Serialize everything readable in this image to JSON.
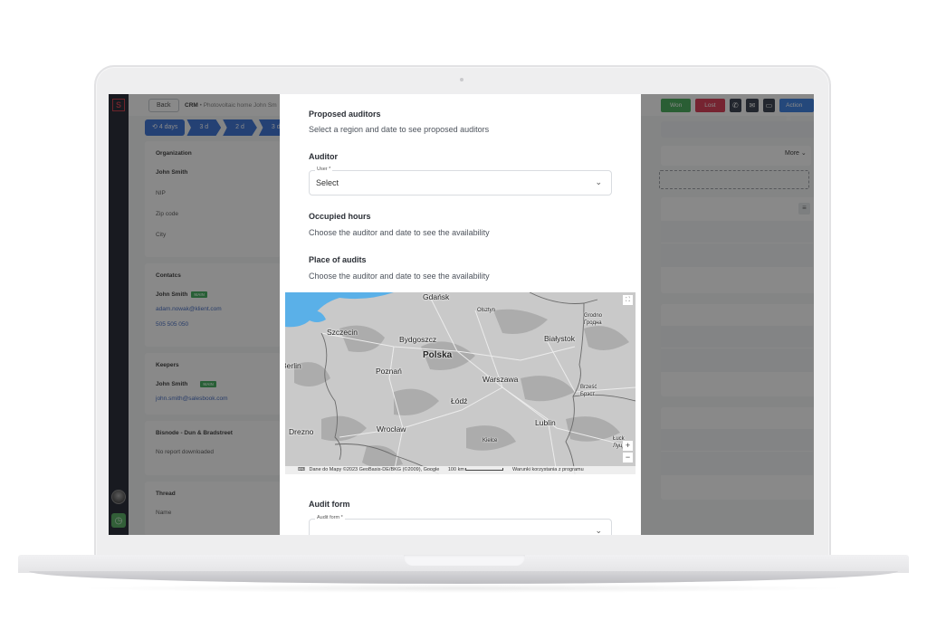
{
  "app": {
    "breadcrumb": {
      "root": "CRM",
      "separator": "•",
      "current": "Photovoltaic home John Sm"
    },
    "back_label": "Back",
    "stages": [
      {
        "label": "4 days",
        "icon": "history-icon"
      },
      {
        "label": "3 d"
      },
      {
        "label": "2 d"
      },
      {
        "label": "3 d"
      }
    ],
    "actions": {
      "won": "Won",
      "lost": "Lost",
      "phone_icon": "phone-icon",
      "mail_icon": "mail-icon",
      "message_icon": "message-icon",
      "action": "Action",
      "more": "More"
    },
    "colors": {
      "won": "#2ea043",
      "lost": "#d4213d",
      "action": "#1f6fe0",
      "stage": "#1f5fd1",
      "nav": "#050a18"
    }
  },
  "left": {
    "organization": {
      "title": "Organization",
      "name": "John Smith",
      "fields": [
        "NIP",
        "Zip code",
        "City"
      ]
    },
    "contacts": {
      "title": "Contatcs",
      "name": "John Smith",
      "badge": "MAIN",
      "email": "adam.nowak@klient.com",
      "phone": "505 505 050"
    },
    "keepers": {
      "title": "Keepers",
      "name": "John Smith",
      "badge": "MAIN",
      "email": "john.smith@salesbook.com"
    },
    "bisnode": {
      "title": "Bisnode - Dun & Bradstreet",
      "text": "No report downloaded"
    },
    "thread": {
      "title": "Thread",
      "field": "Name"
    }
  },
  "modal": {
    "proposed": {
      "title": "Proposed auditors",
      "text": "Select a region and date to see proposed auditors"
    },
    "auditor": {
      "title": "Auditor",
      "legend": "User *",
      "value": "Select"
    },
    "occupied": {
      "title": "Occupied hours",
      "text": "Choose the auditor and date to see the availability"
    },
    "place": {
      "title": "Place of audits",
      "text": "Choose the auditor and date to see the availability"
    },
    "map": {
      "cities": {
        "gdansk": "Gdańsk",
        "olsztyn": "Olsztyn",
        "grodno": "Grodno",
        "grodno_cyr": "Гродна",
        "szczecin": "Szczecin",
        "bydgoszcz": "Bydgoszcz",
        "bialystok": "Białystok",
        "polska": "Polska",
        "berlin": "Berlin",
        "poznan": "Poznań",
        "warszawa": "Warszawa",
        "brzesc": "Brześć",
        "brzesc_cyr": "Брэст",
        "lodz": "Łódź",
        "lublin": "Lublin",
        "wroclaw": "Wrocław",
        "drezno": "Drezno",
        "kielce": "Kielce",
        "luck": "Łuck",
        "luck_cyr": "Луц"
      },
      "attribution": "Dane do Mapy ©2023 GeoBasis-DE/BKG (©2009), Google",
      "scale": "100 km",
      "terms": "Warunki korzystania z programu",
      "zoom_in": "+",
      "zoom_out": "−"
    },
    "audit_form": {
      "title": "Audit form",
      "legend": "Audit form *",
      "value": ""
    }
  }
}
